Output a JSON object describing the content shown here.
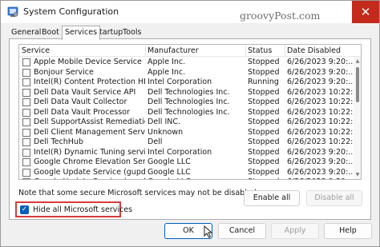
{
  "window": {
    "title": "System Configuration",
    "close_glyph": "✕"
  },
  "watermark": "groovyPost.com",
  "tabs": [
    {
      "label": "General",
      "active": false
    },
    {
      "label": "Boot",
      "active": false
    },
    {
      "label": "Services",
      "active": true
    },
    {
      "label": "Startup",
      "active": false
    },
    {
      "label": "Tools",
      "active": false
    }
  ],
  "services": {
    "columns": [
      "Service",
      "Manufacturer",
      "Status",
      "Date Disabled"
    ],
    "rows": [
      {
        "service": "Apple Mobile Device Service",
        "manufacturer": "Apple Inc.",
        "status": "Stopped",
        "date": "6/26/2023 9:20:..."
      },
      {
        "service": "Bonjour Service",
        "manufacturer": "Apple Inc.",
        "status": "Stopped",
        "date": "6/26/2023 9:20:..."
      },
      {
        "service": "Intel(R) Content Protection HDCP ...",
        "manufacturer": "Intel Corporation",
        "status": "Running",
        "date": "6/26/2023 9:20:..."
      },
      {
        "service": "Dell Data Vault Service API",
        "manufacturer": "Dell Technologies Inc.",
        "status": "Stopped",
        "date": "6/26/2023 10:22:..."
      },
      {
        "service": "Dell Data Vault Collector",
        "manufacturer": "Dell Technologies Inc.",
        "status": "Stopped",
        "date": "6/26/2023 10:22:..."
      },
      {
        "service": "Dell Data Vault Processor",
        "manufacturer": "Dell Technologies Inc.",
        "status": "Stopped",
        "date": "6/26/2023 10:22:..."
      },
      {
        "service": "Dell SupportAssist Remediation",
        "manufacturer": "Dell INC.",
        "status": "Stopped",
        "date": "6/26/2023 10:22:..."
      },
      {
        "service": "Dell Client Management Service",
        "manufacturer": "Unknown",
        "status": "Stopped",
        "date": "6/26/2023 10:22:..."
      },
      {
        "service": "Dell TechHub",
        "manufacturer": "Dell",
        "status": "Stopped",
        "date": "6/26/2023 10:22:..."
      },
      {
        "service": "Intel(R) Dynamic Tuning service",
        "manufacturer": "Intel Corporation",
        "status": "Stopped",
        "date": "6/26/2023 9:20:..."
      },
      {
        "service": "Google Chrome Elevation Service ...",
        "manufacturer": "Google LLC",
        "status": "Stopped",
        "date": "6/26/2023 9:20:..."
      },
      {
        "service": "Google Update Service (gupdate)",
        "manufacturer": "Google LLC",
        "status": "Stopped",
        "date": "6/26/2023 9:20:..."
      },
      {
        "service": "Google Update Service (gupdatem)",
        "manufacturer": "Google LLC",
        "status": "Stopped",
        "date": "6/26/2023 9:20:..."
      }
    ]
  },
  "note": "Note that some secure Microsoft services may not be disabled.",
  "buttons": {
    "enable_all": "Enable all",
    "disable_all": "Disable all",
    "ok": "OK",
    "cancel": "Cancel",
    "apply": "Apply",
    "help": "Help"
  },
  "hide_ms": {
    "label": "Hide all Microsoft services",
    "checked": true,
    "check_glyph": "✓"
  },
  "scroll": {
    "up_glyph": "▲",
    "down_glyph": "▼"
  },
  "colors": {
    "accent": "#005fb8",
    "close": "#c42b1c",
    "highlight_border": "#d83b3b"
  }
}
